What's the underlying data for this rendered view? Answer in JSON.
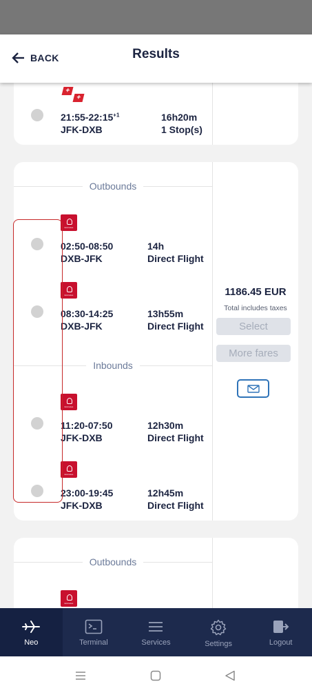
{
  "header": {
    "back_label": "BACK",
    "title": "Results"
  },
  "card1": {
    "flights": [
      {
        "time": "21:55-22:15",
        "day_offset": "+1",
        "route": "JFK-DXB",
        "duration": "16h20m",
        "stops": "1 Stop(s)",
        "airline_icon": "swiss-logo-icon"
      }
    ]
  },
  "card2": {
    "outbounds_title": "Outbounds",
    "inbounds_title": "Inbounds",
    "outbounds": [
      {
        "time": "02:50-08:50",
        "route": "DXB-JFK",
        "duration": "14h",
        "stops": "Direct Flight",
        "airline_icon": "emirates-logo-icon",
        "logo_text": "Emirates"
      },
      {
        "time": "08:30-14:25",
        "route": "DXB-JFK",
        "duration": "13h55m",
        "stops": "Direct Flight",
        "airline_icon": "emirates-logo-icon",
        "logo_text": "Emirates"
      }
    ],
    "inbounds": [
      {
        "time": "11:20-07:50",
        "route": "JFK-DXB",
        "duration": "12h30m",
        "stops": "Direct Flight",
        "airline_icon": "emirates-logo-icon",
        "logo_text": "Emirates"
      },
      {
        "time": "23:00-19:45",
        "route": "JFK-DXB",
        "duration": "12h45m",
        "stops": "Direct Flight",
        "airline_icon": "emirates-logo-icon",
        "logo_text": "Emirates"
      }
    ],
    "price": "1186.45 EUR",
    "taxes_note": "Total includes taxes",
    "select_label": "Select",
    "more_fares_label": "More fares",
    "mail_icon": "envelope-icon"
  },
  "card3": {
    "outbounds_title": "Outbounds",
    "logo_text": "Emirates"
  },
  "nav": {
    "items": [
      {
        "label": "Neo",
        "icon": "plane-icon",
        "active": true
      },
      {
        "label": "Terminal",
        "icon": "terminal-icon"
      },
      {
        "label": "Services",
        "icon": "menu-icon"
      },
      {
        "label": "Settings",
        "icon": "gear-icon"
      },
      {
        "label": "Logout",
        "icon": "logout-icon"
      }
    ]
  },
  "colors": {
    "accent": "#1d2a4d",
    "emirates_red": "#c8102e",
    "selection_red": "#c62828",
    "mail_blue": "#2e73b8"
  }
}
